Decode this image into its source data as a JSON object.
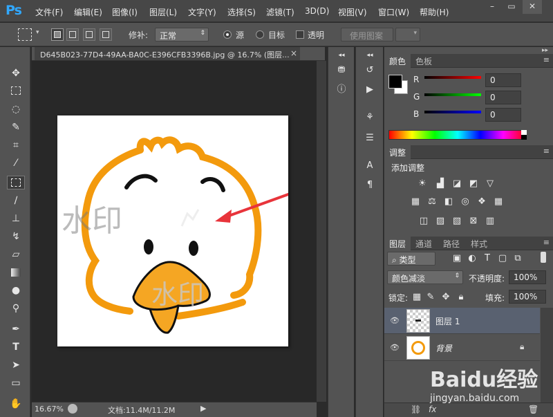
{
  "app": {
    "logo": "Ps"
  },
  "menu": [
    "文件(F)",
    "编辑(E)",
    "图像(I)",
    "图层(L)",
    "文字(Y)",
    "选择(S)",
    "滤镜(T)",
    "3D(D)",
    "视图(V)",
    "窗口(W)",
    "帮助(H)"
  ],
  "window_controls": {
    "minimize": "–",
    "restore": "▭",
    "close": "✕"
  },
  "options": {
    "patch_label": "修补:",
    "patch_mode": "正常",
    "source_label": "源",
    "target_label": "目标",
    "transparent_label": "透明",
    "use_pattern_label": "使用图案",
    "source_selected": true
  },
  "document": {
    "tab_title": "D645B023-77D4-49AA-BA0C-E396CFB3396B.jpg @ 16.7% (图层...",
    "close": "×",
    "zoom": "16.67%",
    "doc_info": "文档:11.4M/11.2M",
    "watermark_text_1": "水印",
    "watermark_text_2": "水印"
  },
  "color_panel": {
    "tabs": [
      "颜色",
      "色板"
    ],
    "r_label": "R",
    "g_label": "G",
    "b_label": "B",
    "r_value": "0",
    "g_value": "0",
    "b_value": "0",
    "foreground": "#000000",
    "background": "#ffffff"
  },
  "adjust_panel": {
    "tab": "调整",
    "add_label": "添加调整"
  },
  "layers_panel": {
    "tabs": [
      "图层",
      "通道",
      "路径",
      "样式"
    ],
    "kind_filter": "类型",
    "blend_mode": "颜色减淡",
    "opacity_label": "不透明度:",
    "opacity_value": "100%",
    "lock_label": "锁定:",
    "fill_label": "填充:",
    "fill_value": "100%",
    "layers": [
      {
        "name": "图层 1",
        "selected": true
      },
      {
        "name": "背景",
        "selected": false,
        "locked": true
      }
    ]
  },
  "watermark_site": {
    "brand": "Baidu经验",
    "url": "jingyan.baidu.com"
  },
  "colors": {
    "accent_blue": "#31a8ff",
    "duck_orange": "#f39a0d",
    "beak": "#f5a623",
    "arrow_red": "#e8343b"
  }
}
